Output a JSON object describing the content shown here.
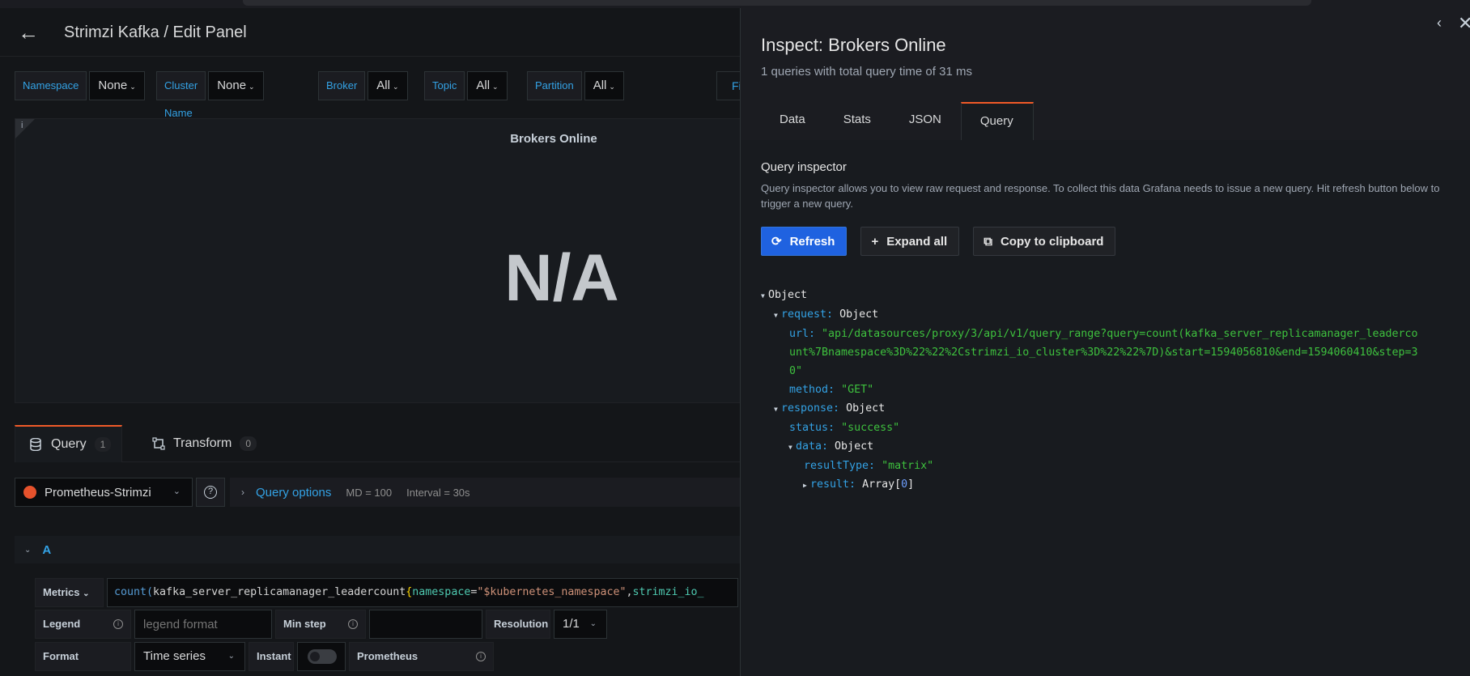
{
  "header": {
    "title": "Strimzi Kafka / Edit Panel"
  },
  "variables": [
    {
      "label": "Namespace",
      "value": "None"
    },
    {
      "label": "Cluster Name",
      "value": "None"
    },
    {
      "label": "Broker",
      "value": "All"
    },
    {
      "label": "Topic",
      "value": "All"
    },
    {
      "label": "Partition",
      "value": "All"
    }
  ],
  "fi_label": "Fi",
  "panel": {
    "title": "Brokers Online",
    "value": "N/A",
    "info": "i"
  },
  "query_tabs": [
    {
      "label": "Query",
      "count": "1"
    },
    {
      "label": "Transform",
      "count": "0"
    }
  ],
  "datasource": {
    "name": "Prometheus-Strimzi"
  },
  "query_options": {
    "label": "Query options",
    "md": "MD = 100",
    "interval": "Interval = 30s"
  },
  "query_row": {
    "ref_id": "A"
  },
  "metrics": {
    "label": "Metrics",
    "expr_fn": "count(",
    "expr_metric": "kafka_server_replicamanager_leadercount",
    "expr_brace": "{",
    "expr_k1": "namespace",
    "expr_eq1": "=",
    "expr_v1": "\"$kubernetes_namespace\"",
    "expr_comma": ",",
    "expr_k2": "strimzi_io_"
  },
  "legend": {
    "label": "Legend",
    "placeholder": "legend format"
  },
  "min_step": {
    "label": "Min step",
    "value": ""
  },
  "resolution": {
    "label": "Resolution",
    "value": "1/1"
  },
  "format": {
    "label": "Format",
    "value": "Time series"
  },
  "instant": {
    "label": "Instant"
  },
  "prometheus_label": "Prometheus",
  "inspect": {
    "title": "Inspect: Brokers Online",
    "subtitle": "1 queries with total query time of 31 ms",
    "tabs": [
      "Data",
      "Stats",
      "JSON",
      "Query"
    ],
    "active_tab": "Query",
    "section_title": "Query inspector",
    "section_desc": "Query inspector allows you to view raw request and response. To collect this data Grafana needs to issue a new query. Hit refresh button below to trigger a new query.",
    "buttons": {
      "refresh": "Refresh",
      "expand": "Expand all",
      "copy": "Copy to clipboard"
    },
    "tree": {
      "root": "Object",
      "request_key": "request:",
      "request_val": "Object",
      "url_key": "url:",
      "url_line1": "\"api/datasources/proxy/3/api/v1/query_range?query=count(kafka_server_replicamanager_leaderco",
      "url_line2": "unt%7Bnamespace%3D%22%22%2Cstrimzi_io_cluster%3D%22%22%7D)&start=1594056810&end=1594060410&step=3",
      "url_line3": "0\"",
      "method_key": "method:",
      "method_val": "\"GET\"",
      "response_key": "response:",
      "response_val": "Object",
      "status_key": "status:",
      "status_val": "\"success\"",
      "data_key": "data:",
      "data_val": "Object",
      "resulttype_key": "resultType:",
      "resulttype_val": "\"matrix\"",
      "result_key": "result:",
      "result_val_prefix": "Array[",
      "result_val_num": "0",
      "result_val_suffix": "]"
    }
  }
}
